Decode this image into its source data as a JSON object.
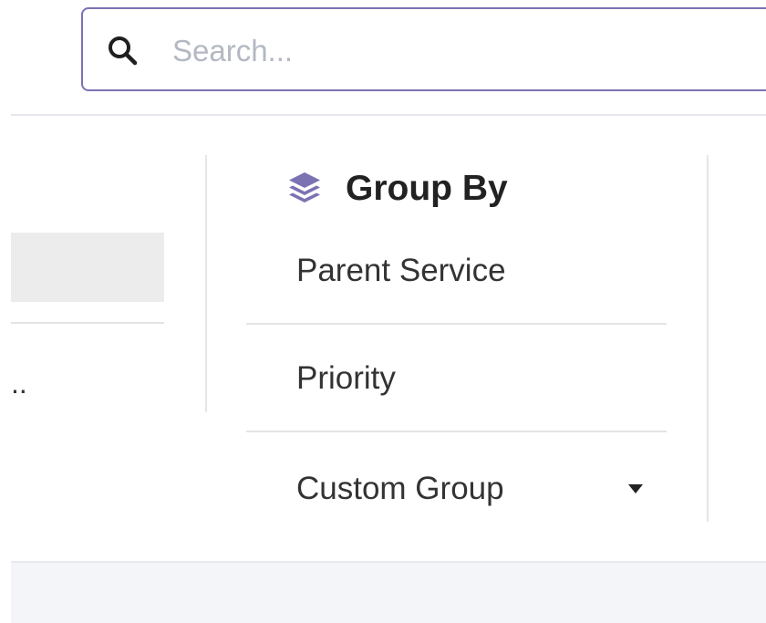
{
  "search": {
    "placeholder": "Search...",
    "value": ""
  },
  "left_column": {
    "truncated_text": ".."
  },
  "group_by": {
    "title": "Group By",
    "icon": "layers-icon",
    "accent_color": "#7b72b3",
    "items": [
      {
        "label": "Parent Service"
      },
      {
        "label": "Priority"
      },
      {
        "label": "Custom Group",
        "has_dropdown": true
      }
    ]
  },
  "colors": {
    "search_border": "#7b72b3",
    "placeholder": "#b3b8c2",
    "divider": "#e4e4e4",
    "bottom_bar": "#f4f5f8"
  }
}
